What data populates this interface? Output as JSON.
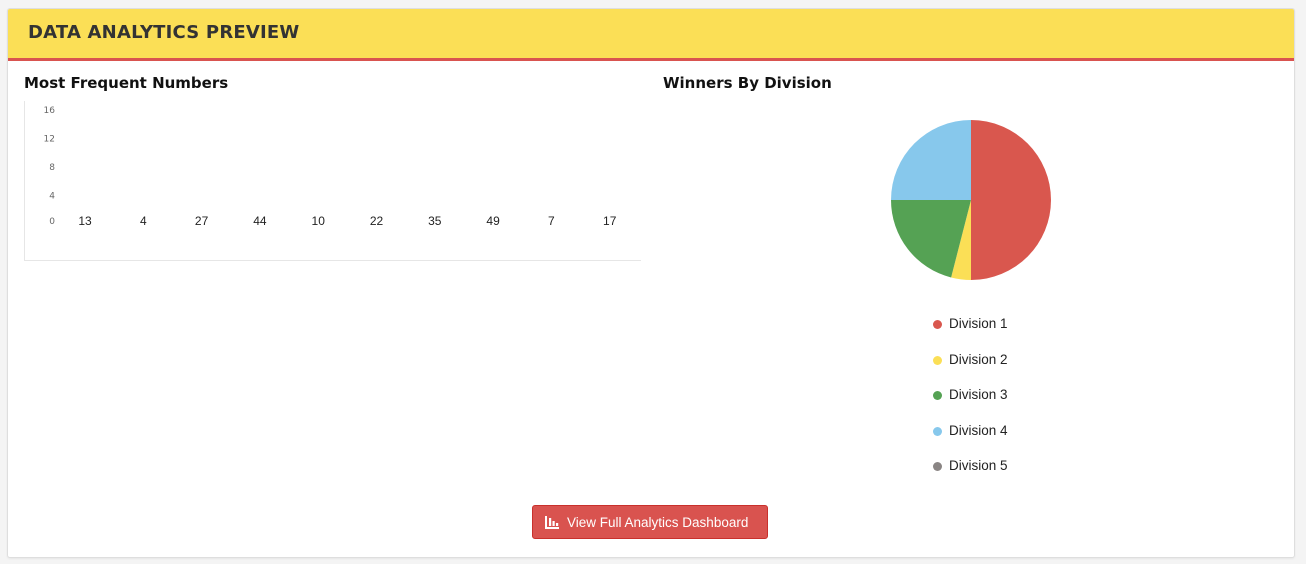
{
  "header": {
    "title": "DATA ANALYTICS PREVIEW"
  },
  "frequent_numbers": {
    "title": "Most Frequent Numbers"
  },
  "winners_by_division": {
    "title": "Winners By Division",
    "legend": [
      {
        "label": "Division 1",
        "color": "#d9574e"
      },
      {
        "label": "Division 2",
        "color": "#fbdf56"
      },
      {
        "label": "Division 3",
        "color": "#55a254"
      },
      {
        "label": "Division 4",
        "color": "#87c8ec"
      },
      {
        "label": "Division 5",
        "color": "#8a8584"
      }
    ]
  },
  "actions": {
    "dashboard_button_label": "View Full Analytics Dashboard",
    "dashboard_button_icon": "bar-chart-icon"
  },
  "chart_data": [
    {
      "type": "bar",
      "title": "Most Frequent Numbers",
      "categories": [
        "13",
        "4",
        "27",
        "44",
        "10",
        "22",
        "35",
        "49",
        "7",
        "17"
      ],
      "values": [
        0,
        0,
        0,
        0,
        0,
        0,
        0,
        0,
        0,
        0
      ],
      "y_ticks": [
        0,
        4,
        8,
        12,
        16
      ],
      "ylim": [
        0,
        16
      ],
      "grid": false,
      "bar_color": "#d9574e"
    },
    {
      "type": "pie",
      "title": "Winners By Division",
      "labels": [
        "Division 1",
        "Division 2",
        "Division 3",
        "Division 4",
        "Division 5"
      ],
      "values": [
        50,
        4,
        21,
        25,
        0
      ],
      "colors": [
        "#d9574e",
        "#fbdf56",
        "#55a254",
        "#87c8ec",
        "#8a8584"
      ],
      "legend": "bottom"
    }
  ]
}
